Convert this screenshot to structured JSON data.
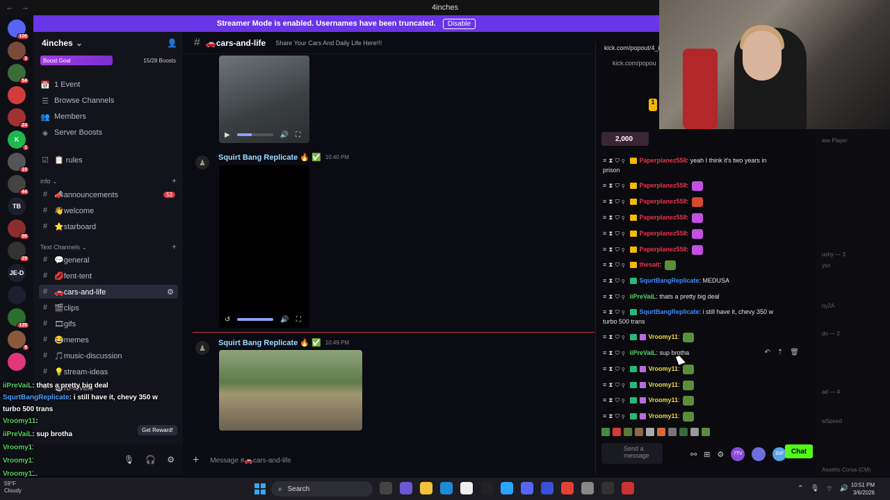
{
  "window": {
    "title": "4inches"
  },
  "banner": {
    "text": "Streamer Mode is enabled. Usernames have been truncated.",
    "button": "Disable"
  },
  "rail": {
    "servers": [
      {
        "label": "",
        "badge": "106",
        "color": "#5865f2"
      },
      {
        "label": "",
        "badge": "3",
        "color": "#7b4b3a"
      },
      {
        "label": "",
        "badge": "54",
        "color": "#3b6d3b"
      },
      {
        "label": "",
        "badge": "",
        "color": "#d43c3c"
      },
      {
        "label": "",
        "badge": "24",
        "color": "#a23232"
      },
      {
        "label": "K",
        "badge": "1",
        "color": "#1fb84a"
      },
      {
        "label": "",
        "badge": "10",
        "color": "#555"
      },
      {
        "label": "",
        "badge": "44",
        "color": "#444"
      },
      {
        "label": "TB",
        "badge": "",
        "color": "#1e1f2e"
      },
      {
        "label": "",
        "badge": "56",
        "color": "#8b2d2d"
      },
      {
        "label": "",
        "badge": "29",
        "color": "#333"
      },
      {
        "label": "JE-D",
        "badge": "",
        "color": "#1e1f2e"
      },
      {
        "label": "",
        "badge": "",
        "color": "#1e1f2e"
      },
      {
        "label": "",
        "badge": "135",
        "color": "#2c6e2c"
      },
      {
        "label": "",
        "badge": "8",
        "color": "#8a5a3a"
      },
      {
        "label": "",
        "badge": "",
        "color": "#e0367a"
      }
    ]
  },
  "sidebar": {
    "server_name": "4inches",
    "boost_label": "Boost Goal",
    "boost_count": "15/28 Boosts",
    "boost_progress": 0.54,
    "items": [
      {
        "icon": "calendar",
        "label": "1 Event"
      },
      {
        "icon": "browse",
        "label": "Browse Channels"
      },
      {
        "icon": "members",
        "label": "Members"
      },
      {
        "icon": "boost",
        "label": "Server Boosts"
      },
      {
        "icon": "rules",
        "label": "📋 rules"
      }
    ],
    "info_category": "info",
    "info_channels": [
      {
        "label": "📣announcements",
        "badge": "53"
      },
      {
        "label": "👋welcome",
        "badge": ""
      },
      {
        "label": "⭐starboard",
        "badge": ""
      }
    ],
    "text_category": "Text Channels",
    "text_channels": [
      {
        "label": "💬general",
        "selected": false
      },
      {
        "label": "💋fent-tent",
        "selected": false
      },
      {
        "label": "🚗cars-and-life",
        "selected": true
      },
      {
        "label": "🎬clips",
        "selected": false
      },
      {
        "label": "🎞gifs",
        "selected": false
      },
      {
        "label": "😂memes",
        "selected": false
      },
      {
        "label": "🎵music-discussion",
        "selected": false
      },
      {
        "label": "💡stream-ideas",
        "selected": false
      },
      {
        "label": "🕹ro-levels",
        "selected": false
      }
    ],
    "reward_button": "Get Reward!"
  },
  "overlay_chat": [
    {
      "name": "iiPreVaiL",
      "text": "thats a pretty big deal"
    },
    {
      "name": "SqurtBangReplicate",
      "text": "i still have it, chevy 350 w"
    },
    {
      "name": "",
      "text": "turbo 500 trans"
    },
    {
      "name": "Vroomy11",
      "text": ""
    },
    {
      "name": "iiPreVaiL",
      "text": "sup brotha"
    },
    {
      "name": "Vroomy11",
      "text": ""
    },
    {
      "name": "Vroomy11",
      "text": ""
    },
    {
      "name": "Vroomy11",
      "text": ""
    },
    {
      "name": "Vroomy11",
      "text": ""
    }
  ],
  "main": {
    "channel_name": "🚗cars-and-life",
    "topic": "Share Your Cars And Daily Life Here!!!",
    "messages": [
      {
        "author": "Squirt Bang Replicate 🔥 ✅",
        "time": "10:40 PM"
      },
      {
        "author": "Squirt Bang Replicate 🔥 ✅",
        "time": "10:49 PM"
      }
    ],
    "input_placeholder": "Message #🚗cars-and-life"
  },
  "kick": {
    "url": "kick.com/popout/4_in",
    "url2": "kick.com/popou",
    "points": "2,000",
    "coin": "1",
    "messages": [
      {
        "user": "Paperplanez558",
        "color": "#e8354b",
        "text": "yeah I think it's two years in",
        "cont": "prison",
        "badge": "y",
        "emote": ""
      },
      {
        "user": "Paperplanez558",
        "color": "#e8354b",
        "text": "",
        "cont": "",
        "badge": "y",
        "emote": "#c44fe0"
      },
      {
        "user": "Paperplanez558",
        "color": "#e8354b",
        "text": "",
        "cont": "",
        "badge": "y",
        "emote": "#d6492c"
      },
      {
        "user": "Paperplanez558",
        "color": "#e8354b",
        "text": "",
        "cont": "",
        "badge": "y",
        "emote": "#c44fe0"
      },
      {
        "user": "Paperplanez558",
        "color": "#e8354b",
        "text": "",
        "cont": "",
        "badge": "y",
        "emote": "#c44fe0"
      },
      {
        "user": "Paperplanez558",
        "color": "#e8354b",
        "text": "",
        "cont": "",
        "badge": "y",
        "emote": "#c44fe0"
      },
      {
        "user": "thesalt",
        "color": "#e8354b",
        "text": "",
        "cont": "",
        "badge": "y",
        "emote": "#5a8f3a"
      },
      {
        "user": "SqurtBangReplicate",
        "color": "#3d8bff",
        "text": "MEDUSA",
        "cont": "",
        "badge": "g",
        "emote": ""
      },
      {
        "user": "iiPreVaiL",
        "color": "#56d264",
        "text": "thats a pretty big deal",
        "cont": "",
        "badge": "",
        "emote": ""
      },
      {
        "user": "SqurtBangReplicate",
        "color": "#3d8bff",
        "text": "i still have it, chevy 350 w",
        "cont": "turbo 500 trans",
        "badge": "g",
        "emote": ""
      },
      {
        "user": "Vroomy11",
        "color": "#f0d64a",
        "text": "",
        "cont": "",
        "badge": "gp",
        "emote": "#5a8f3a"
      },
      {
        "user": "iiPreVaiL",
        "color": "#56d264",
        "text": "sup brotha",
        "cont": "",
        "badge": "",
        "emote": ""
      },
      {
        "user": "Vroomy11",
        "color": "#f0d64a",
        "text": "",
        "cont": "",
        "badge": "gp",
        "emote": "#5a8f3a"
      },
      {
        "user": "Vroomy11",
        "color": "#f0d64a",
        "text": "",
        "cont": "",
        "badge": "gp",
        "emote": "#5a8f3a"
      },
      {
        "user": "Vroomy11",
        "color": "#f0d64a",
        "text": "",
        "cont": "",
        "badge": "gp",
        "emote": "#5a8f3a"
      },
      {
        "user": "Vroomy11",
        "color": "#f0d64a",
        "text": "",
        "cont": "",
        "badge": "gp",
        "emote": "#5a8f3a"
      }
    ],
    "send_placeholder": "Send a message",
    "chat_button": "Chat",
    "pills": [
      "7TV",
      "",
      "GIF"
    ]
  },
  "rightpane": {
    "rows": [
      "iew Player",
      "ushy — 3",
      "ysn",
      "ny2A",
      "do — 2",
      "ad — 4",
      "wSpeed",
      "Assetto Corsa (CM)"
    ]
  },
  "taskbar": {
    "weather_temp": "59°F",
    "weather_desc": "Cloudy",
    "search": "Search",
    "time": "10:51 PM",
    "date": "3/6/2026"
  }
}
